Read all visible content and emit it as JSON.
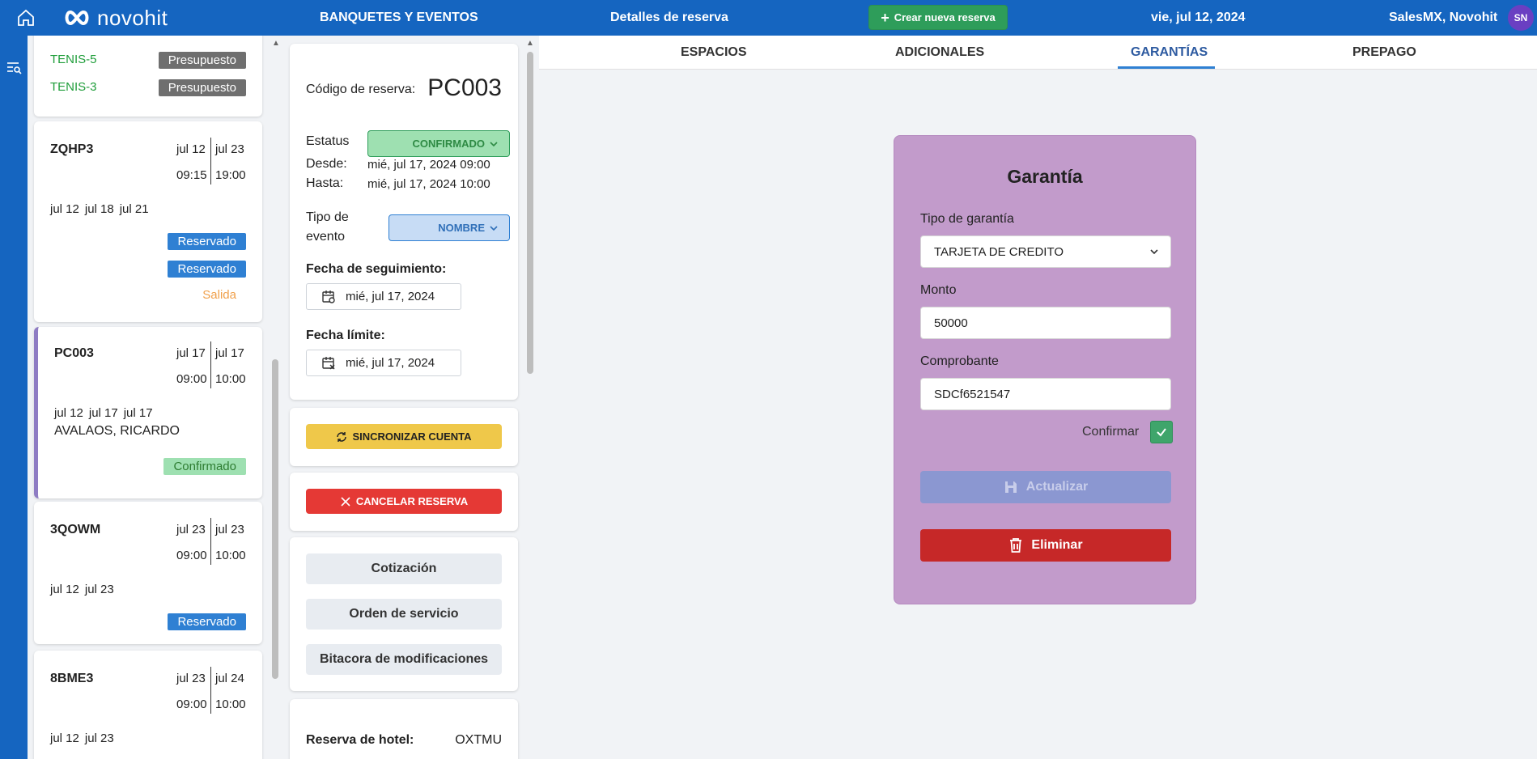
{
  "topbar": {
    "logo_text": "novohit",
    "module_title": "BANQUETES Y EVENTOS",
    "details_title": "Detalles de reserva",
    "new_booking_label": "Crear nueva reserva",
    "date": "vie, jul 12, 2024",
    "user": "SalesMX, Novohit",
    "avatar_initials": "SN"
  },
  "list": {
    "top_card": {
      "items": [
        {
          "name": "TENIS-5",
          "badge": "Presupuesto"
        },
        {
          "name": "TENIS-3",
          "badge": "Presupuesto"
        }
      ]
    },
    "cards": [
      {
        "code": "ZQHP3",
        "date_from": "jul 12",
        "date_to": "jul 23",
        "time_from": "09:15",
        "time_to": "19:00",
        "dates": [
          "jul 12",
          "jul 18",
          "jul 21"
        ],
        "badges": [
          "Reservado",
          "Reservado"
        ],
        "extra": "Salida"
      },
      {
        "code": "PC003",
        "date_from": "jul 17",
        "date_to": "jul 17",
        "time_from": "09:00",
        "time_to": "10:00",
        "dates": [
          "jul 12",
          "jul 17",
          "jul 17"
        ],
        "client": "AVALAOS, RICARDO",
        "badges": [
          "Confirmado"
        ]
      },
      {
        "code": "3QOWM",
        "date_from": "jul 23",
        "date_to": "jul 23",
        "time_from": "09:00",
        "time_to": "10:00",
        "dates": [
          "jul 12",
          "jul 23"
        ],
        "badges": [
          "Reservado"
        ]
      },
      {
        "code": "8BME3",
        "date_from": "jul 23",
        "date_to": "jul 24",
        "time_from": "09:00",
        "time_to": "10:00",
        "dates": [
          "jul 12",
          "jul 23"
        ],
        "badges": []
      }
    ]
  },
  "details": {
    "code_label": "Código de reserva:",
    "code_value": "PC003",
    "status_label": "Estatus",
    "status_value": "CONFIRMADO",
    "from_label": "Desde:",
    "from_value": "mié, jul 17, 2024 09:00",
    "to_label": "Hasta:",
    "to_value": "mié, jul 17, 2024 10:00",
    "event_type_label_1": "Tipo de",
    "event_type_label_2": "evento",
    "event_type_value": "NOMBRE",
    "followup_label": "Fecha de seguimiento:",
    "followup_value": "mié, jul 17, 2024",
    "deadline_label": "Fecha límite:",
    "deadline_value": "mié, jul 17, 2024",
    "sync_label": "SINCRONIZAR CUENTA",
    "cancel_label": "CANCELAR RESERVA",
    "quote_label": "Cotización",
    "service_order_label": "Orden de servicio",
    "log_label": "Bitacora de modificaciones",
    "hotel_label": "Reserva de hotel:",
    "hotel_value": "OXTMU"
  },
  "tabs": [
    "ESPACIOS",
    "ADICIONALES",
    "GARANTÍAS",
    "PREPAGO"
  ],
  "active_tab": "GARANTÍAS",
  "guarantee": {
    "title": "Garantía",
    "type_label": "Tipo de garantía",
    "type_value": "TARJETA DE CREDITO",
    "amount_label": "Monto",
    "amount_value": "50000",
    "voucher_label": "Comprobante",
    "voucher_value": "SDCf6521547",
    "confirm_label": "Confirmar",
    "confirm_checked": true,
    "update_label": "Actualizar",
    "delete_label": "Eliminar"
  },
  "colors": {
    "topbar": "#1565c0",
    "guarantee_card": "#c29bcb",
    "reservado": "#2f80d3",
    "presupuesto": "#6f6f6f",
    "confirmado_bg": "#9ee0b1",
    "delete": "#c62828",
    "update_disabled": "#8b97d1"
  }
}
